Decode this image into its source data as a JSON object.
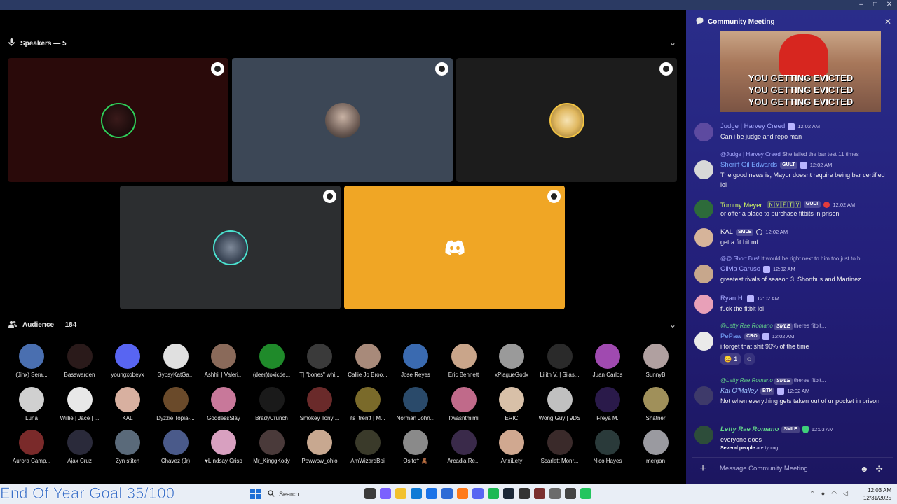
{
  "window": {
    "controls": [
      "–",
      "□",
      "✕"
    ]
  },
  "speakers": {
    "heading": "Speakers — 5"
  },
  "audience": {
    "heading": "Audience — 184"
  },
  "audience_members": [
    [
      "(Jinx) Sera...",
      "Basswarden",
      "youngxobeyx",
      "GypsyKatGa...",
      "Ashhii | Valeri...",
      "(deer)toxicde...",
      "T| \"bones\" whi...",
      "Callie Jo Broo...",
      "Jose Reyes",
      "Eric Bennett",
      "xPlagueGodx",
      "Lilith V. | Silas...",
      "Juan Carlos",
      "SunnyB"
    ],
    [
      "Luna",
      "Willie | Jace | ...",
      "KAL",
      "Dyzzie Topia-...",
      "GoddessSlay",
      "BradyCrunch",
      "Smokey Tony ...",
      "its_trentt | M...",
      "Norman John...",
      "Itwasntmimi",
      "ERIC",
      "Wong Guy | 9DS",
      "Freya M.",
      "Shatner"
    ],
    [
      "Aurora Camp...",
      "Ajax Cruz",
      "Zyn stitch",
      "Chavez (Jr)",
      "♥LIndsay Crisp",
      "Mr_KinggKody",
      "Powwow_ohio",
      "AmWizardBoi",
      "Osito† 🧸",
      "Arcadia Re...",
      "AnxiLety",
      "Scarlett Monr...",
      "Nico Hayes",
      "mergan"
    ]
  ],
  "chat": {
    "title": "Community Meeting",
    "gif_text": [
      "YOU GETTING EVICTED",
      "YOU GETTING EVICTED",
      "YOU GETTING EVICTED"
    ],
    "messages": [
      {
        "name": "Judge | Harvey Creed",
        "time": "12:02 AM",
        "text": "Can i be judge and repo man"
      },
      {
        "reply_to": "@Judge | Harvey Creed",
        "reply_text": "She failed the bar test 11 times",
        "name": "Sheriff Gil Edwards",
        "badge": "GULT",
        "time": "12:02 AM",
        "text": "The good news is, Mayor doesnt require being bar certified lol"
      },
      {
        "name": "Tommy Meyer | 🄽🄼🄵🅃🅅",
        "badge": "GULT",
        "time": "12:02 AM",
        "text": "or offer a place to purchase fitbits in prison"
      },
      {
        "name": "KAL",
        "badge": "SMLE",
        "time": "12:02 AM",
        "text": "get a fit bit mf"
      },
      {
        "reply_to": "@@ Short Bus!",
        "reply_text": "It would be right next to him too just to b...",
        "name": "Olivia Caruso",
        "time": "12:02 AM",
        "text": "greatest rivals of season 3, Shortbus and Martinez"
      },
      {
        "name": "Ryan H.",
        "time": "12:02 AM",
        "text": "fuck the fitbit lol"
      },
      {
        "reply_to": "@Letty Rae Romano",
        "reply_badge": "SMLE",
        "reply_text": "theres fitbit...",
        "name": "PePaw",
        "badge": "CRO",
        "time": "12:02 AM",
        "text": "i forget that shit 90% of the time",
        "reaction": "😄",
        "reaction_count": "1"
      },
      {
        "reply_to": "@Letty Rae Romano",
        "reply_badge": "SMLE",
        "reply_text": "theres fitbit...",
        "name": "Kai O'Malley",
        "badge": "BTK",
        "time": "12:02 AM",
        "text": "Not when everything gets taken out of ur pocket in prison"
      },
      {
        "name": "Letty Rae Romano",
        "badge": "SMLE",
        "time": "12:03 AM",
        "text": "everyone does"
      }
    ],
    "typing_who": "Several people",
    "typing_rest": " are typing...",
    "input_placeholder": "Message Community Meeting"
  },
  "overlay": {
    "goal_text": "End Of Year Goal 35/100"
  },
  "taskbar": {
    "search_placeholder": "Search",
    "time": "12:03 AM",
    "date": "12/31/2025"
  },
  "colors": {
    "tile_dark_red": "#2a0a0a",
    "tile_slate": "#3c4756",
    "tile_dark": "#1c1c1c",
    "tile_gray": "#2c2e30",
    "tile_orange": "#f0a625",
    "name_judge": "#a6a9ff",
    "name_sheriff": "#7aa8ff",
    "name_tommy": "#d7ff63",
    "name_green": "#63d28a"
  }
}
